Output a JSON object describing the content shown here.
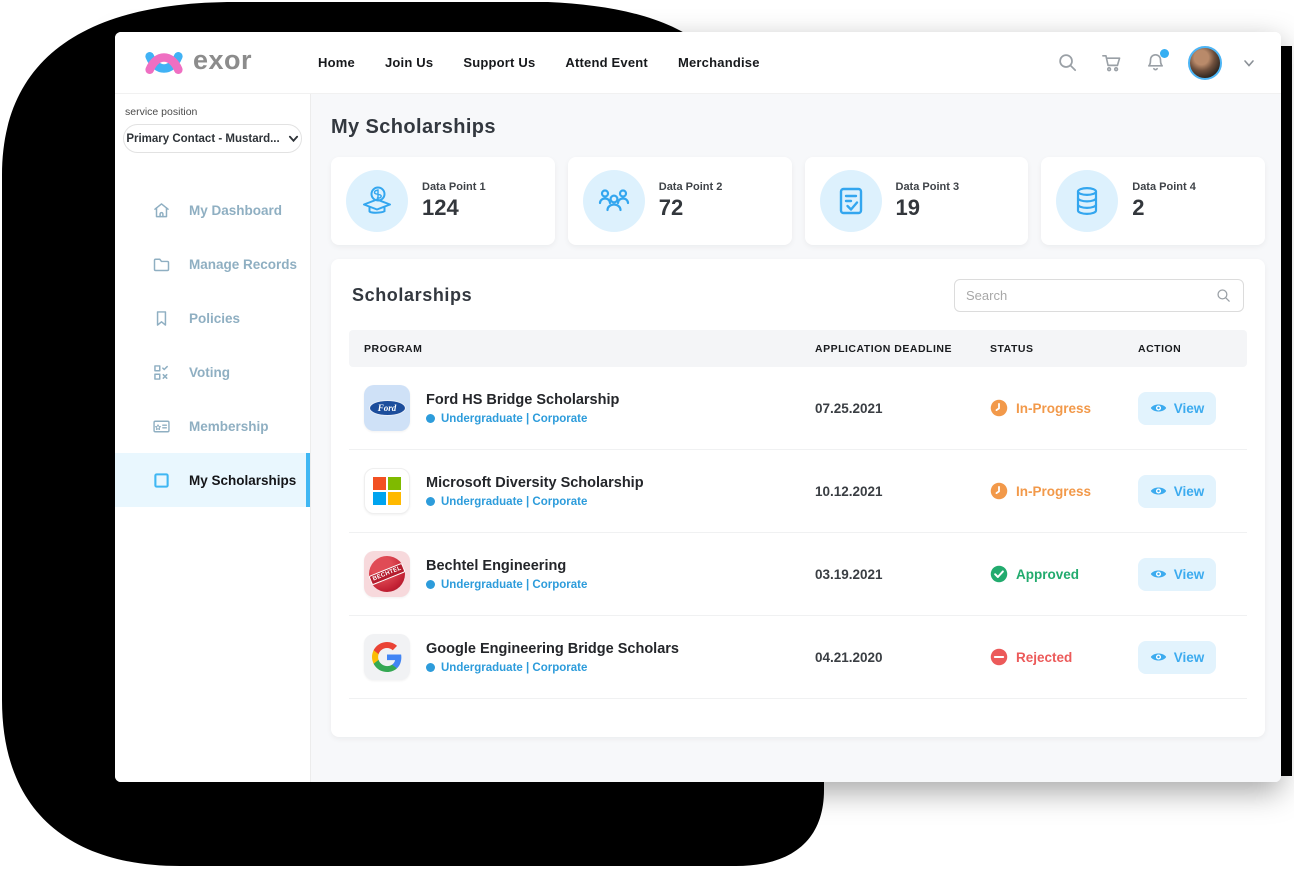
{
  "navbar": {
    "brand": "exor",
    "links": [
      {
        "label": "Home"
      },
      {
        "label": "Join Us"
      },
      {
        "label": "Support Us"
      },
      {
        "label": "Attend Event"
      },
      {
        "label": "Merchandise"
      }
    ],
    "icons": [
      "search-icon",
      "cart-icon",
      "bell-icon"
    ],
    "has_notification": true
  },
  "sidebar": {
    "service_position_label": "service position",
    "service_position_value": "Primary Contact - Mustard...",
    "items": [
      {
        "label": "My Dashboard",
        "icon": "home-icon",
        "active": false
      },
      {
        "label": "Manage Records",
        "icon": "folder-icon",
        "active": false
      },
      {
        "label": "Policies",
        "icon": "bookmark-icon",
        "active": false
      },
      {
        "label": "Voting",
        "icon": "ballot-icon",
        "active": false
      },
      {
        "label": "Membership",
        "icon": "membership-card-icon",
        "active": false
      },
      {
        "label": "My Scholarships",
        "icon": "square-icon",
        "active": true
      }
    ]
  },
  "page": {
    "title": "My Scholarships"
  },
  "stats": [
    {
      "label": "Data Point 1",
      "value": "124",
      "icon": "scholarship-cap-dollar-icon"
    },
    {
      "label": "Data Point 2",
      "value": "72",
      "icon": "people-group-icon"
    },
    {
      "label": "Data Point 3",
      "value": "19",
      "icon": "checklist-icon"
    },
    {
      "label": "Data Point 4",
      "value": "2",
      "icon": "database-icon"
    }
  ],
  "scholarships": {
    "title": "Scholarships",
    "search_placeholder": "Search",
    "columns": [
      "PROGRAM",
      "APPLICATION DEADLINE",
      "STATUS",
      "ACTION"
    ],
    "rows": [
      {
        "program": "Ford HS Bridge Scholarship",
        "tags": "Undergraduate | Corporate",
        "deadline": "07.25.2021",
        "status": "In-Progress",
        "status_type": "in-progress",
        "action": "View",
        "logo": "ford-logo"
      },
      {
        "program": "Microsoft Diversity Scholarship",
        "tags": "Undergraduate | Corporate",
        "deadline": "10.12.2021",
        "status": "In-Progress",
        "status_type": "in-progress",
        "action": "View",
        "logo": "microsoft-logo"
      },
      {
        "program": "Bechtel Engineering",
        "tags": "Undergraduate | Corporate",
        "deadline": "03.19.2021",
        "status": "Approved",
        "status_type": "approved",
        "action": "View",
        "logo": "bechtel-logo"
      },
      {
        "program": "Google Engineering Bridge Scholars",
        "tags": "Undergraduate | Corporate",
        "deadline": "04.21.2020",
        "status": "Rejected",
        "status_type": "rejected",
        "action": "View",
        "logo": "google-logo"
      }
    ]
  },
  "colors": {
    "accent": "#35aef2",
    "accent_light": "#ddf1fd",
    "in_progress": "#f2994a",
    "approved": "#22ab6e",
    "rejected": "#ec5a5a",
    "tag_blue": "#2d9cdb",
    "brand_pink": "#ef6fc2",
    "brand_blue": "#41b2f5"
  }
}
